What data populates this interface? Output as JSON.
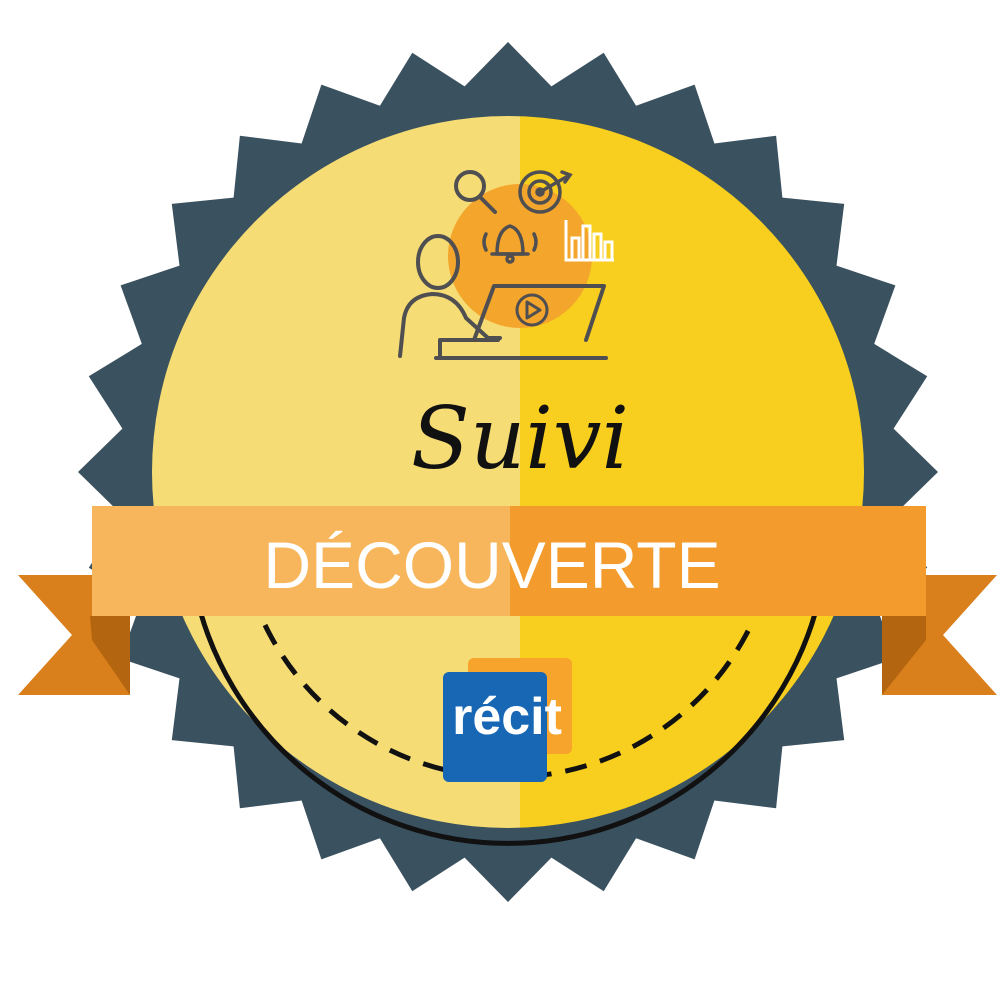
{
  "badge": {
    "title": "Suivi",
    "ribbon_label": "DÉCOUVERTE",
    "logo_text": "récit",
    "icon_names": [
      "person-at-laptop-icon",
      "magnifier-icon",
      "target-icon",
      "bell-icon",
      "bar-chart-icon",
      "play-icon"
    ],
    "colors": {
      "seal_edge": "#3a5160",
      "disc_left": "#f5dc74",
      "disc_right": "#f8cf1e",
      "ribbon_left": "#f7b65c",
      "ribbon_right": "#f39b2c",
      "ribbon_tail": "#f0981e",
      "ribbon_fold": "#c86f16",
      "icon_circle": "#f3a52c",
      "line_art": "#4f4f52",
      "logo_blue": "#1767b4",
      "logo_orange": "#f6a42b"
    }
  }
}
